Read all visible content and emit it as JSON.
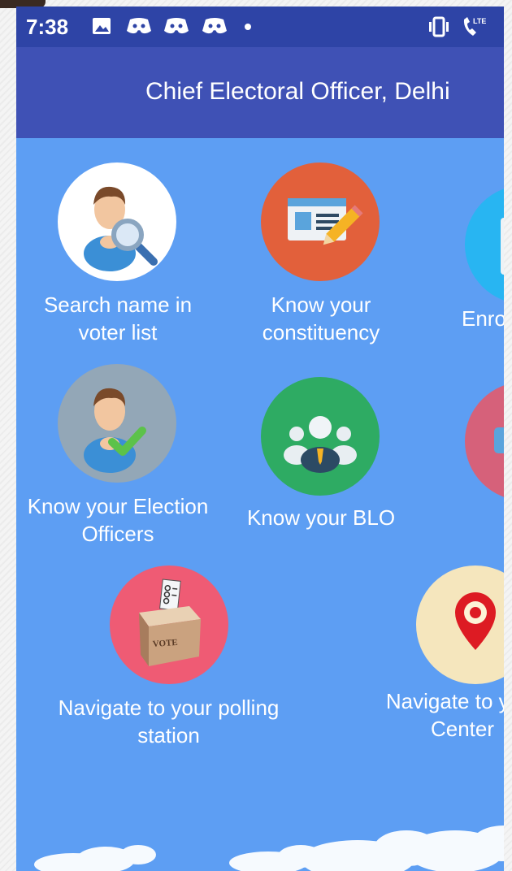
{
  "status_bar": {
    "time": "7:38"
  },
  "app_bar": {
    "title": "Chief Electoral Officer, Delhi"
  },
  "tiles": [
    {
      "label_line1": "Search name in",
      "label_line2": "voter list"
    },
    {
      "label_line1": "Know your",
      "label_line2": "constituency"
    },
    {
      "label_line1": "Enro",
      "label_line2": ""
    },
    {
      "label_line1": "Know your Election",
      "label_line2": "Officers"
    },
    {
      "label_line1": "Know your BLO",
      "label_line2": ""
    },
    {
      "label_line1": "Navigate to your polling",
      "label_line2": "station"
    },
    {
      "label_line1": "Navigate to yo",
      "label_line2": "Center"
    }
  ],
  "icons": {
    "ballot_box_text": "VOTE"
  },
  "colors": {
    "status_bar": "#2e44a6",
    "app_bar": "#3f51b5",
    "background": "#5d9ef3"
  }
}
